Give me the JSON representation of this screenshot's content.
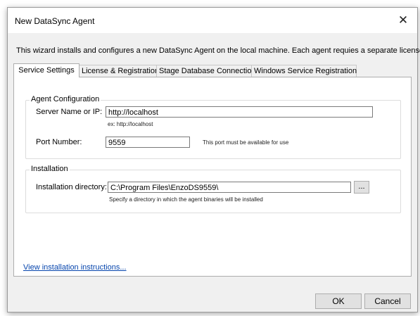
{
  "window": {
    "title": "New DataSync Agent",
    "close_icon": "close-icon"
  },
  "intro_text": "This wizard installs and configures a new DataSync Agent on the local machine. Each agent requies a separate license.",
  "tabs": [
    {
      "label": "Service Settings",
      "active": true
    },
    {
      "label": "License & Registration",
      "active": false
    },
    {
      "label": "Stage Database Connection",
      "active": false
    },
    {
      "label": "Windows Service Registration",
      "active": false
    }
  ],
  "agent_config": {
    "group_label": "Agent Configuration",
    "server_label": "Server Name or IP:",
    "server_value": "http://localhost",
    "server_hint": "ex: http://localhost",
    "port_label": "Port Number:",
    "port_value": "9559",
    "port_hint": "This port must be available for use"
  },
  "installation": {
    "group_label": "Installation",
    "dir_label": "Installation directory:",
    "dir_value": "C:\\Program Files\\EnzoDS9559\\",
    "browse_label": "...",
    "dir_hint": "Specify a directory in which the agent binaries will be installed"
  },
  "instructions_link": "View installation instructions...",
  "buttons": {
    "ok": "OK",
    "cancel": "Cancel"
  }
}
